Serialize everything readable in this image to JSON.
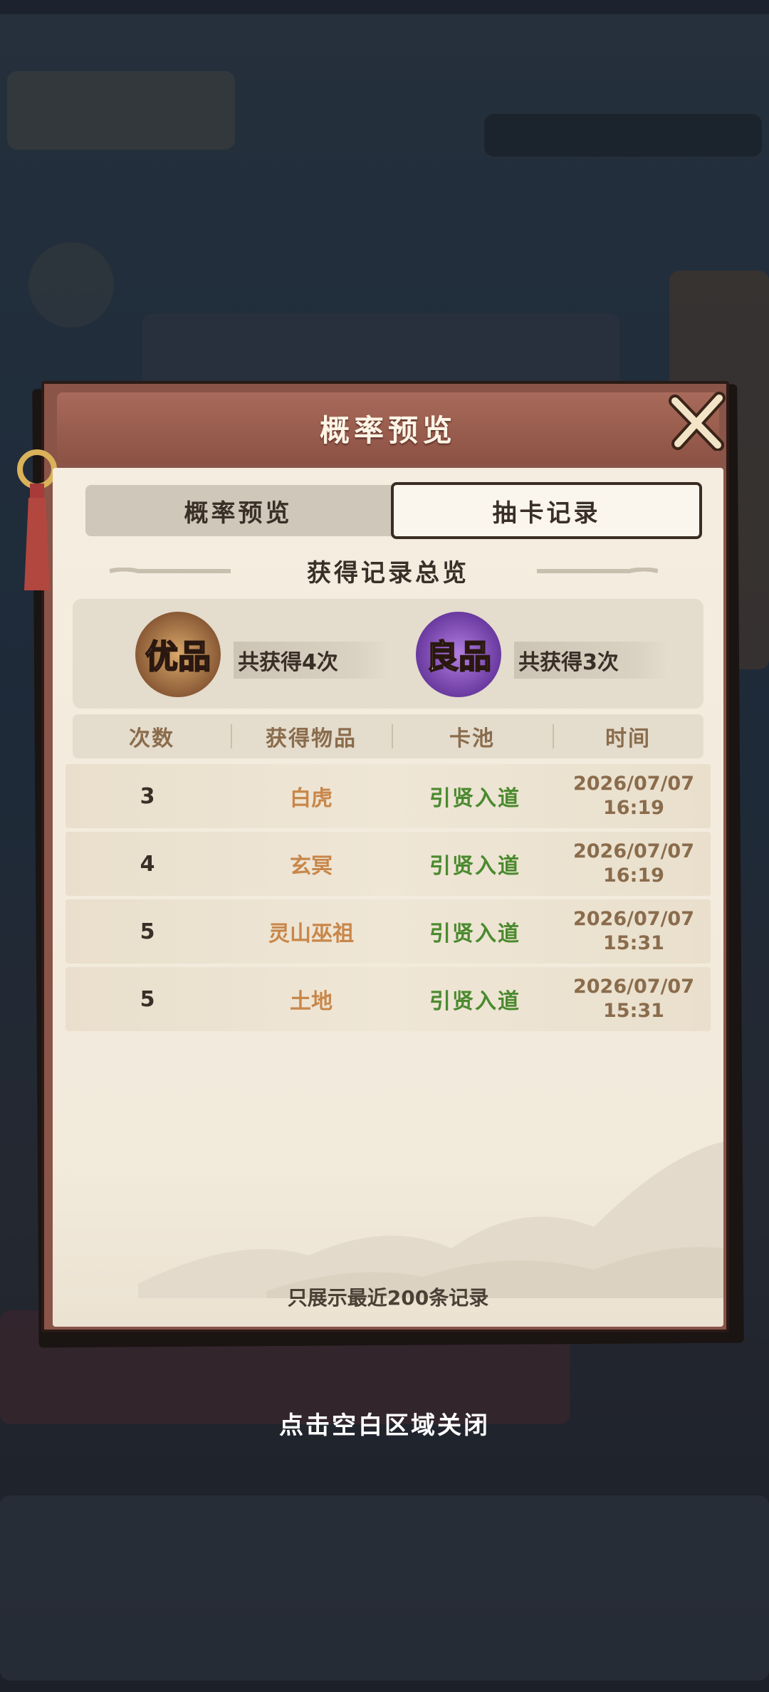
{
  "modal": {
    "title": "概率预览",
    "tabs": [
      {
        "label": "概率预览",
        "active": false
      },
      {
        "label": "抽卡记录",
        "active": true
      }
    ],
    "summary": {
      "title": "获得记录总览",
      "badges": [
        {
          "grade": "优品",
          "count_text": "共获得4次",
          "color": "#c8874a"
        },
        {
          "grade": "良品",
          "count_text": "共获得3次",
          "color": "#8a4fc4"
        }
      ]
    },
    "table": {
      "headers": [
        "次数",
        "获得物品",
        "卡池",
        "时间"
      ],
      "rows": [
        {
          "count": "3",
          "item": "白虎",
          "pool": "引贤入道",
          "date": "2026/07/07",
          "time": "16:19"
        },
        {
          "count": "4",
          "item": "玄冥",
          "pool": "引贤入道",
          "date": "2026/07/07",
          "time": "16:19"
        },
        {
          "count": "5",
          "item": "灵山巫祖",
          "pool": "引贤入道",
          "date": "2026/07/07",
          "time": "15:31"
        },
        {
          "count": "5",
          "item": "土地",
          "pool": "引贤入道",
          "date": "2026/07/07",
          "time": "15:31"
        }
      ]
    },
    "footer_note": "只展示最近200条记录"
  },
  "close_hint": "点击空白区域关闭",
  "icons": {
    "close": "close-x-icon"
  }
}
